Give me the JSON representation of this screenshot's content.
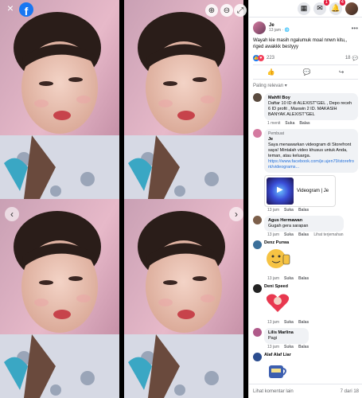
{
  "viewer": {
    "close": "×",
    "zoom_in": "⊕",
    "zoom_out": "⊖",
    "fullscreen": "⤢",
    "prev": "‹",
    "next": "›"
  },
  "topbar": {
    "notif_badge": "4",
    "msg_badge": "1"
  },
  "post": {
    "author": "Je",
    "time": "13 jam · ",
    "text": "Wayah kie masih ngalumuk moal nnwn kitu,, riged awakkk bestyyy",
    "reaction_count": "223",
    "comment_count": "18"
  },
  "sort_label": "Paling relevan ▾",
  "comments": [
    {
      "name": "Mahfil Boy",
      "text": "Daftar 10 ID di ALEXIST\"GEL , Depo receh 6 ID profit , Maxwin 2 ID. MAKASIH BANYAK ALEXIST\"GEL",
      "time": "1 menit",
      "like": "Suka",
      "reply": "Balas"
    },
    {
      "name": "Je",
      "sponsor": "Pembuat",
      "text": "Saya menawarkan videogram di Storefront saya! Mintalah video khusus untuk Anda, teman, atau keluarga.",
      "link": "https://www.facebook.com/je.ujen79/storefront/videograms...",
      "card_title": "Videogram | Je",
      "time": "13 jam",
      "like": "Suka",
      "reply": "Balas"
    },
    {
      "name": "Agus Hermawan",
      "text": "Gugah gera sarapan",
      "time": "13 jam",
      "like": "Suka",
      "reply": "Balas",
      "translate": "Lihat terjemahan"
    },
    {
      "name": "Denz Purwa",
      "time": "13 jam",
      "like": "Suka",
      "reply": "Balas"
    },
    {
      "name": "Deni Speed",
      "time": "13 jam",
      "like": "Suka",
      "reply": "Balas"
    },
    {
      "name": "Lilis Marlina",
      "text": "Pagi",
      "time": "13 jam",
      "like": "Suka",
      "reply": "Balas"
    },
    {
      "name": "Alaf Alaf Liar"
    }
  ],
  "footer": {
    "more": "Lihat komentar lain",
    "count": "7 dari 18"
  }
}
